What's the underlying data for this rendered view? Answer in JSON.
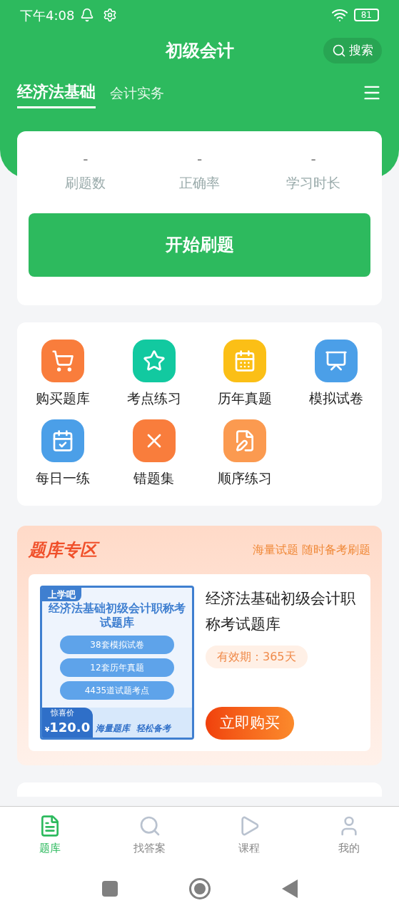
{
  "status_bar": {
    "time": "下午4:08",
    "battery": "81"
  },
  "header": {
    "title": "初级会计",
    "search": "搜索"
  },
  "tabs": [
    {
      "label": "经济法基础",
      "selected": true
    },
    {
      "label": "会计实务",
      "selected": false
    }
  ],
  "stats": [
    {
      "value": "-",
      "label": "刷题数"
    },
    {
      "value": "-",
      "label": "正确率"
    },
    {
      "value": "-",
      "label": "学习时长"
    }
  ],
  "start_button": "开始刷题",
  "features": [
    {
      "label": "购买题库",
      "kind": "cart",
      "color": "#f97d3c"
    },
    {
      "label": "考点练习",
      "kind": "star",
      "color": "#12c9a0"
    },
    {
      "label": "历年真题",
      "kind": "calendar",
      "color": "#fbbf16"
    },
    {
      "label": "模拟试卷",
      "kind": "board",
      "color": "#4b9fe8"
    },
    {
      "label": "每日一练",
      "kind": "check",
      "color": "#4b9fe8"
    },
    {
      "label": "错题集",
      "kind": "wrong",
      "color": "#f97d3c"
    },
    {
      "label": "顺序练习",
      "kind": "note",
      "color": "#fb9a50"
    }
  ],
  "promo": {
    "title": "题库专区",
    "slogan": "海量试题 随时备考刷题",
    "product": {
      "banner": {
        "brand": "上学吧",
        "title": "经济法基础初级会计职称考试题库",
        "points": [
          "38套模拟试卷",
          "12套历年真题",
          "4435道试题考点"
        ],
        "price_label": "惊喜价",
        "currency": "¥",
        "price": "120.0",
        "tagline": "海量题库  轻松备考"
      },
      "name": "经济法基础初级会计职称考试题库",
      "validity": "有效期：365天",
      "buy": "立即购买"
    }
  },
  "bottom_nav": [
    {
      "label": "题库",
      "kind": "bank",
      "selected": true
    },
    {
      "label": "找答案",
      "kind": "find",
      "selected": false
    },
    {
      "label": "课程",
      "kind": "play",
      "selected": false
    },
    {
      "label": "我的",
      "kind": "user",
      "selected": false
    }
  ]
}
